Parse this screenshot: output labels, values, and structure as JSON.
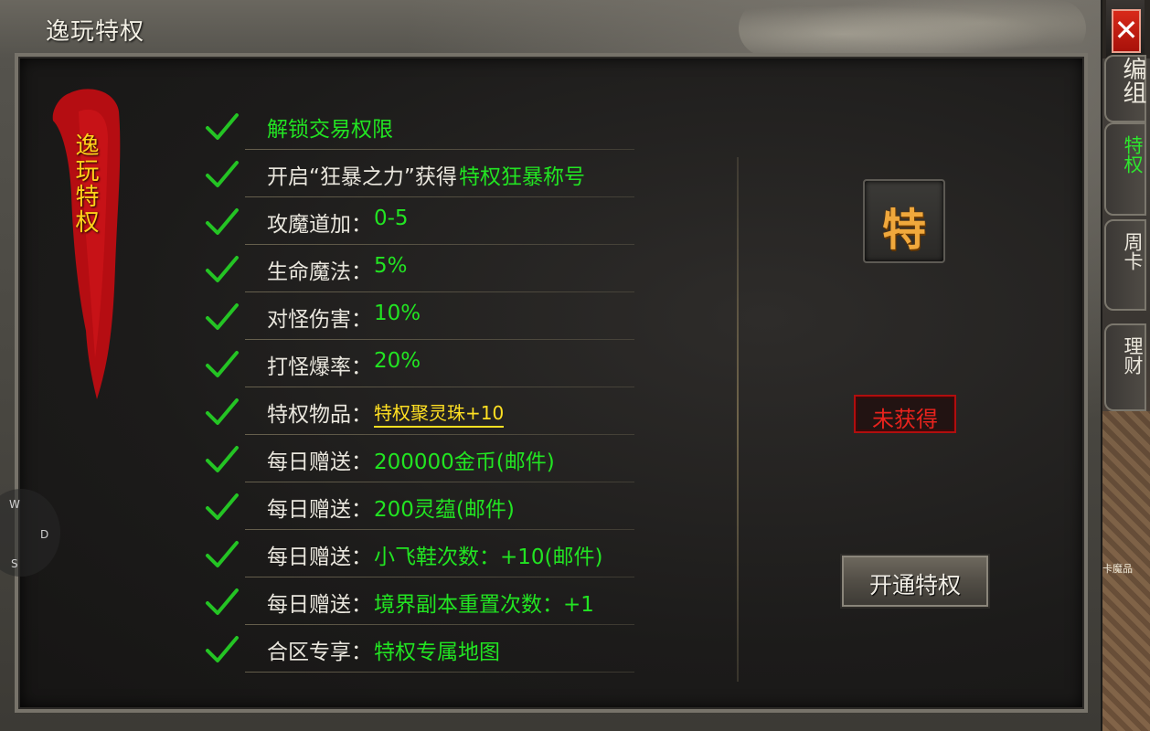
{
  "window": {
    "title": "逸玩特权",
    "close_icon": "close-icon"
  },
  "banner": {
    "text": "逸玩特权"
  },
  "privileges": [
    {
      "label": "解锁交易权限",
      "value": "",
      "label_color": "#22e422"
    },
    {
      "label": "开启“狂暴之力”获得",
      "value": "特权狂暴称号"
    },
    {
      "label": "攻魔道加：",
      "value": "0-5"
    },
    {
      "label": "生命魔法：",
      "value": "5%"
    },
    {
      "label": "对怪伤害：",
      "value": "10%"
    },
    {
      "label": "打怪爆率：",
      "value": "20%"
    },
    {
      "label": "特权物品：",
      "value": "特权聚灵珠+10",
      "link": true
    },
    {
      "label": "每日赠送：",
      "value": "200000金币(邮件)"
    },
    {
      "label": "每日赠送：",
      "value": "200灵蕴(邮件)"
    },
    {
      "label": "每日赠送：",
      "value": "小飞鞋次数：+10(邮件)"
    },
    {
      "label": "每日赠送：",
      "value": "境界副本重置次数：+1"
    },
    {
      "label": "合区专享：",
      "value": "特权专属地图"
    }
  ],
  "badge": {
    "text": "特"
  },
  "status": {
    "text": "未获得"
  },
  "activate_button": {
    "label": "开通特权"
  },
  "side_tabs": [
    {
      "label": "编组",
      "state": "partial"
    },
    {
      "label": "特权",
      "state": "active"
    },
    {
      "label": "周卡",
      "state": "normal"
    },
    {
      "label": "理财",
      "state": "normal"
    }
  ],
  "scene_label": "卡魔品",
  "compass": {
    "w": "W",
    "d": "D",
    "s": "S"
  },
  "colors": {
    "value_green": "#22e422",
    "item_yellow": "#ffe022",
    "status_red": "#e8231d",
    "badge_gold": "#f0a83c"
  }
}
